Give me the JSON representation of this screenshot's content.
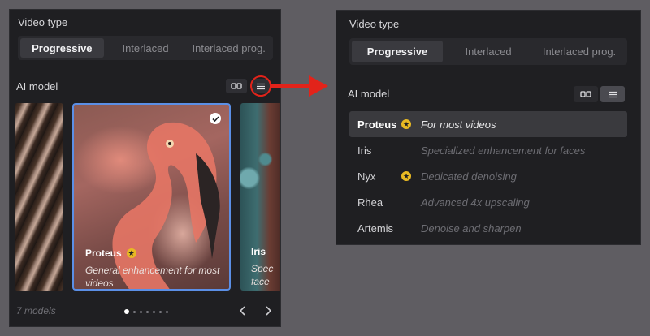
{
  "left_panel": {
    "video_type_title": "Video type",
    "video_types": [
      "Progressive",
      "Interlaced",
      "Interlaced prog."
    ],
    "ai_model_title": "AI model",
    "cards": [
      {
        "name": "Proteus",
        "starred": true,
        "description": "General enhancement for most videos"
      },
      {
        "name": "Iris",
        "starred": false,
        "description": "Spec face"
      }
    ],
    "model_count": "7 models",
    "page_dots": 7,
    "active_dot": 0
  },
  "right_panel": {
    "video_type_title": "Video type",
    "video_types": [
      "Progressive",
      "Interlaced",
      "Interlaced prog."
    ],
    "ai_model_title": "AI model",
    "models": [
      {
        "name": "Proteus",
        "starred": true,
        "description": "For most videos",
        "selected": true
      },
      {
        "name": "Iris",
        "starred": false,
        "description": "Specialized enhancement for faces"
      },
      {
        "name": "Nyx",
        "starred": true,
        "description": "Dedicated denoising"
      },
      {
        "name": "Rhea",
        "starred": false,
        "description": "Advanced 4x upscaling"
      },
      {
        "name": "Artemis",
        "starred": false,
        "description": "Denoise and sharpen"
      }
    ]
  },
  "colors": {
    "accent_highlight": "#e2231a",
    "selected_card_border": "#5b8fe6",
    "star": "#e8b923"
  }
}
